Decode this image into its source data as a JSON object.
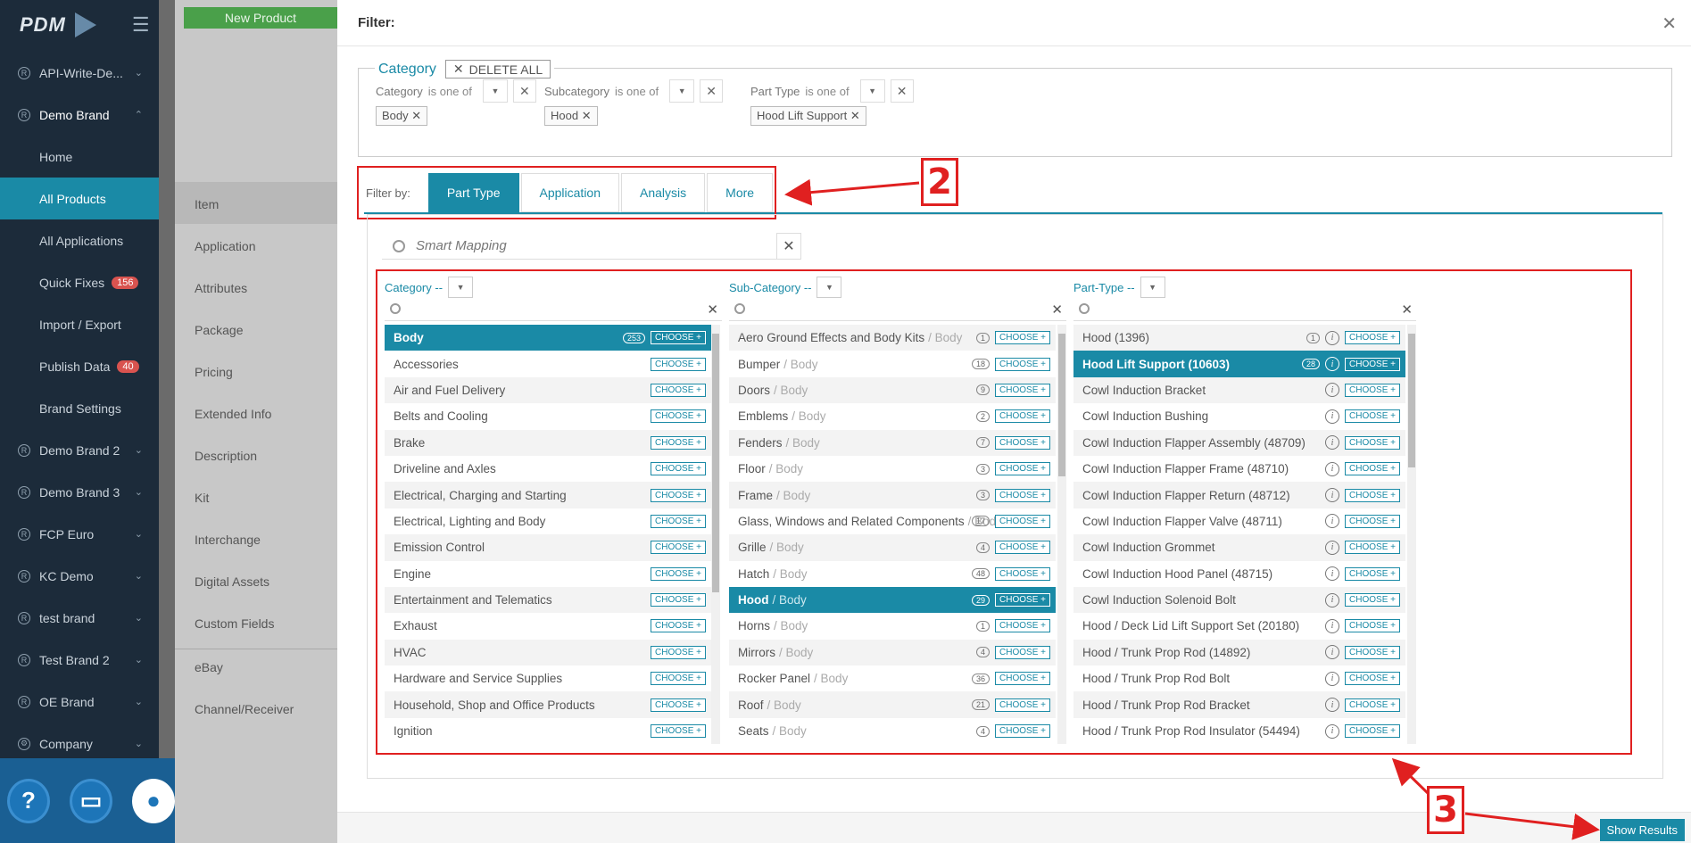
{
  "sidebar": {
    "brand": "PDM",
    "items": [
      {
        "label": "API-Write-De..."
      },
      {
        "label": "Demo Brand"
      },
      {
        "label": "Demo Brand 2"
      },
      {
        "label": "Demo Brand 3"
      },
      {
        "label": "FCP Euro"
      },
      {
        "label": "KC Demo"
      },
      {
        "label": "test brand"
      },
      {
        "label": "Test Brand 2"
      },
      {
        "label": "OE Brand"
      },
      {
        "label": "Company"
      }
    ],
    "sub_items": [
      {
        "label": "Home"
      },
      {
        "label": "All Products"
      },
      {
        "label": "All Applications"
      },
      {
        "label": "Quick Fixes",
        "badge": "156"
      },
      {
        "label": "Import / Export"
      },
      {
        "label": "Publish Data",
        "badge": "40"
      },
      {
        "label": "Brand Settings"
      }
    ]
  },
  "secondary": {
    "new_product": "New Product",
    "items": [
      "Item",
      "Application",
      "Attributes",
      "Package",
      "Pricing",
      "Extended Info",
      "Description",
      "Kit",
      "Interchange",
      "Digital Assets",
      "Custom Fields",
      "eBay",
      "Channel/Receiver"
    ]
  },
  "modal": {
    "title": "Filter:",
    "category_legend": "Category",
    "delete_all": "DELETE ALL",
    "filters": [
      {
        "field": "Category",
        "op": "is one of",
        "chip": "Body"
      },
      {
        "field": "Subcategory",
        "op": "is one of",
        "chip": "Hood"
      },
      {
        "field": "Part Type",
        "op": "is one of",
        "chip": "Hood Lift Support"
      }
    ],
    "filter_by_label": "Filter by:",
    "tabs": [
      "Part Type",
      "Application",
      "Analysis",
      "More"
    ],
    "smart_mapping_placeholder": "Smart Mapping",
    "choose_label": "CHOOSE +",
    "show_results": "Show Results",
    "columns": {
      "category": {
        "header": "Category --",
        "rows": [
          {
            "label": "Body",
            "count": "253",
            "selected": true
          },
          {
            "label": "Accessories"
          },
          {
            "label": "Air and Fuel Delivery"
          },
          {
            "label": "Belts and Cooling"
          },
          {
            "label": "Brake"
          },
          {
            "label": "Driveline and Axles"
          },
          {
            "label": "Electrical, Charging and Starting"
          },
          {
            "label": "Electrical, Lighting and Body"
          },
          {
            "label": "Emission Control"
          },
          {
            "label": "Engine"
          },
          {
            "label": "Entertainment and Telematics"
          },
          {
            "label": "Exhaust"
          },
          {
            "label": "HVAC"
          },
          {
            "label": "Hardware and Service Supplies"
          },
          {
            "label": "Household, Shop and Office Products"
          },
          {
            "label": "Ignition"
          }
        ]
      },
      "subcategory": {
        "header": "Sub-Category --",
        "rows": [
          {
            "label": "Aero Ground Effects and Body Kits",
            "sub": "/ Body",
            "count": "1"
          },
          {
            "label": "Bumper",
            "sub": "/ Body",
            "count": "18"
          },
          {
            "label": "Doors",
            "sub": "/ Body",
            "count": "9"
          },
          {
            "label": "Emblems",
            "sub": "/ Body",
            "count": "2"
          },
          {
            "label": "Fenders",
            "sub": "/ Body",
            "count": "7"
          },
          {
            "label": "Floor",
            "sub": "/ Body",
            "count": "3"
          },
          {
            "label": "Frame",
            "sub": "/ Body",
            "count": "3"
          },
          {
            "label": "Glass, Windows and Related Components",
            "sub": "/ Body",
            "count": "17"
          },
          {
            "label": "Grille",
            "sub": "/ Body",
            "count": "4"
          },
          {
            "label": "Hatch",
            "sub": "/ Body",
            "count": "48"
          },
          {
            "label": "Hood",
            "sub": "/ Body",
            "count": "29",
            "selected": true
          },
          {
            "label": "Horns",
            "sub": "/ Body",
            "count": "1"
          },
          {
            "label": "Mirrors",
            "sub": "/ Body",
            "count": "4"
          },
          {
            "label": "Rocker Panel",
            "sub": "/ Body",
            "count": "36"
          },
          {
            "label": "Roof",
            "sub": "/ Body",
            "count": "21"
          },
          {
            "label": "Seats",
            "sub": "/ Body",
            "count": "4"
          }
        ]
      },
      "parttype": {
        "header": "Part-Type --",
        "rows": [
          {
            "label": "Hood (1396)",
            "count": "1"
          },
          {
            "label": "Hood Lift Support (10603)",
            "count": "28",
            "selected": true
          },
          {
            "label": "Cowl Induction Bracket"
          },
          {
            "label": "Cowl Induction Bushing"
          },
          {
            "label": "Cowl Induction Flapper Assembly (48709)"
          },
          {
            "label": "Cowl Induction Flapper Frame (48710)"
          },
          {
            "label": "Cowl Induction Flapper Return (48712)"
          },
          {
            "label": "Cowl Induction Flapper Valve (48711)"
          },
          {
            "label": "Cowl Induction Grommet"
          },
          {
            "label": "Cowl Induction Hood Panel (48715)"
          },
          {
            "label": "Cowl Induction Solenoid Bolt"
          },
          {
            "label": "Hood / Deck Lid Lift Support Set (20180)"
          },
          {
            "label": "Hood / Trunk Prop Rod (14892)"
          },
          {
            "label": "Hood / Trunk Prop Rod Bolt"
          },
          {
            "label": "Hood / Trunk Prop Rod Bracket"
          },
          {
            "label": "Hood / Trunk Prop Rod Insulator (54494)"
          }
        ]
      }
    }
  },
  "annotations": {
    "a2": "2",
    "a3": "3"
  },
  "colors": {
    "accent": "#1a8aa6",
    "sidebar": "#1c2b3a",
    "annotation": "#e02020"
  }
}
